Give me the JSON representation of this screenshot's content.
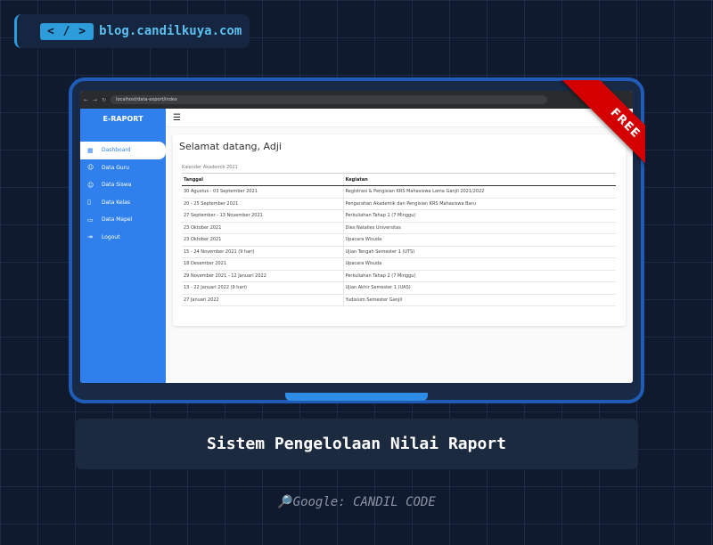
{
  "header": {
    "code_icon": "< / >",
    "site": "blog.candilkuya.com"
  },
  "browser": {
    "url": "localhost/data-export/index"
  },
  "app": {
    "sidebar": {
      "title": "E-RAPORT",
      "items": [
        {
          "label": "Dashboard",
          "icon": "grid-icon",
          "glyph": "▦"
        },
        {
          "label": "Data Guru",
          "icon": "user-icon",
          "glyph": "☺"
        },
        {
          "label": "Data Siswa",
          "icon": "user-icon",
          "glyph": "☺"
        },
        {
          "label": "Data Kelas",
          "icon": "door-icon",
          "glyph": "▯"
        },
        {
          "label": "Data Mapel",
          "icon": "book-icon",
          "glyph": "▭"
        },
        {
          "label": "Logout",
          "icon": "logout-icon",
          "glyph": "⇥"
        }
      ]
    },
    "topbar": {
      "menu_glyph": "☰"
    },
    "welcome": "Selamat datang, Adji",
    "calendar": {
      "caption": "Kalender Akademik 2021",
      "columns": [
        "Tanggal",
        "Kegiatan"
      ],
      "rows": [
        [
          "30 Agustus - 03 September 2021",
          "Registrasi & Pengisian KRS Mahasiswa Lama Ganjil 2021/2022"
        ],
        [
          "20 - 25 September 2021",
          "Pengarahan Akademik dan Pengisian KRS Mahasiswa Baru"
        ],
        [
          "27 September - 13 November 2021",
          "Perkuliahan Tahap 1 (7 Minggu)"
        ],
        [
          "23 Oktober 2021",
          "Dies Natalies Universitas"
        ],
        [
          "23 Oktober 2021",
          "Upacara Wisuda"
        ],
        [
          "15 - 24 November 2021 (9 hari)",
          "Ujian Tengah Semester 1 (UTS)"
        ],
        [
          "18 Desember 2021",
          "Upacara Wisuda"
        ],
        [
          "29 November 2021 - 12 Januari 2022",
          "Perkuliahan Tahap 2 (7 Minggu)"
        ],
        [
          "13 - 22 Januari 2022 (9 hari)",
          "Ujian Akhir Semester 1 (UAS)"
        ],
        [
          "27 Januari 2022",
          "Yudisium Semester Ganjil"
        ]
      ]
    }
  },
  "ribbon": "FREE",
  "title": "Sistem Pengelolaan Nilai Raport",
  "footer": {
    "icon": "magnifier-icon",
    "text": "Google: CANDIL CODE"
  },
  "colors": {
    "background": "#0f1a2e",
    "sidebar": "#2f80ed",
    "ribbon": "#d40000",
    "frame": "#1e5cb8",
    "accent": "#2d9cdb"
  }
}
